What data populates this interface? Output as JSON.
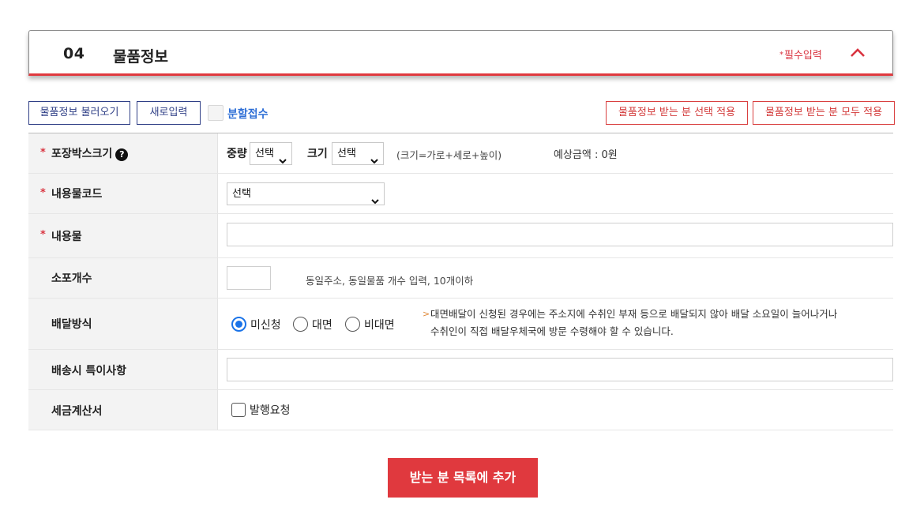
{
  "section": {
    "number": "04",
    "title": "물품정보",
    "required_mark": "*",
    "required_label": "필수입력"
  },
  "toolbar": {
    "load_button": "물품정보 불러오기",
    "new_button": "새로입력",
    "split_label": "분할접수",
    "split_checked": false,
    "apply_selected_button": "물품정보 받는 분 선택 적용",
    "apply_all_button": "물품정보 받는 분 모두 적용"
  },
  "form": {
    "required_star": "*",
    "box_size": {
      "label": "포장박스크기",
      "help_icon": "?",
      "weight_label": "중량",
      "weight_value": "선택",
      "size_label": "크기",
      "size_value": "선택",
      "size_hint": "(크기=가로+세로+높이)",
      "estimate": "예상금액 : 0원"
    },
    "content_code": {
      "label": "내용물코드",
      "value": "선택"
    },
    "content": {
      "label": "내용물",
      "value": ""
    },
    "parcel_count": {
      "label": "소포개수",
      "value": "",
      "hint": "동일주소, 동일물품 개수 입력, 10개이하"
    },
    "delivery_method": {
      "label": "배달방식",
      "options": [
        "미신청",
        "대면",
        "비대면"
      ],
      "selected": "미신청",
      "note_bullet": ">",
      "note_line1": "대면배달이 신청된 경우에는 주소지에 수취인 부재 등으로 배달되지 않아 배달 소요일이 늘어나거나",
      "note_line2": "수취인이 직접 배달우체국에 방문 수령해야 할 수 있습니다."
    },
    "special_notes": {
      "label": "배송시 특이사항",
      "value": ""
    },
    "tax_invoice": {
      "label": "세금계산서",
      "checkbox_label": "발행요청",
      "checked": false
    }
  },
  "submit": {
    "label": "받는 분 목록에 추가"
  },
  "colors": {
    "accent_red": "#e0393e",
    "navy": "#2f3f86",
    "link_blue": "#2f6fd6",
    "radio_blue": "#1a73e8"
  },
  "icons": {
    "collapse": "chevron-up-icon",
    "help": "question-circle-icon",
    "select_arrow": "chevron-down-icon"
  }
}
